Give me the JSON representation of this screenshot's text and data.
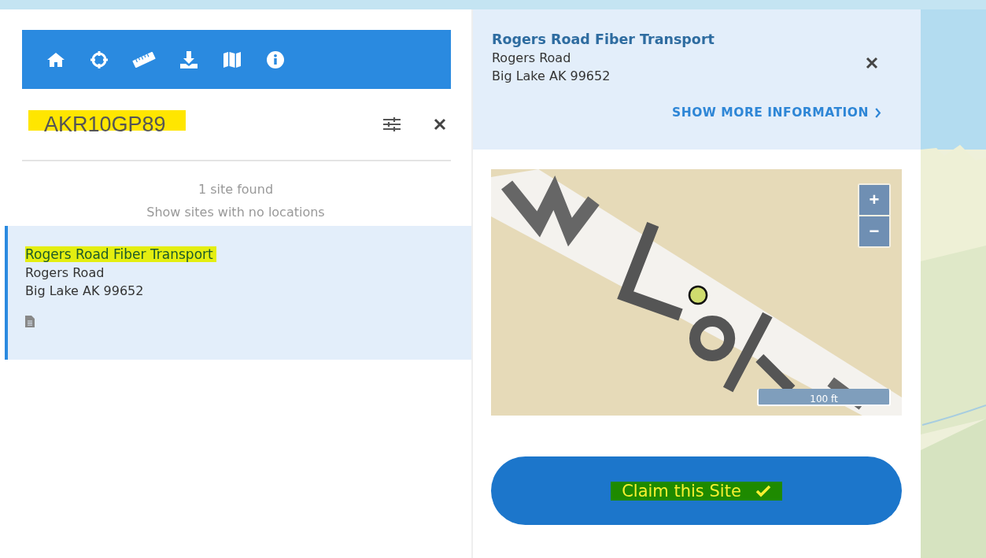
{
  "toolbar": {
    "buttons": [
      {
        "kind": "home"
      },
      {
        "kind": "locate"
      },
      {
        "kind": "measure"
      },
      {
        "kind": "download"
      },
      {
        "kind": "basemap"
      },
      {
        "kind": "info"
      }
    ]
  },
  "search": {
    "value": "AKR10GP89",
    "highlighted": true
  },
  "results": {
    "count": "1 site found",
    "no_location_link": "Show sites with no locations",
    "items": [
      {
        "name": "Rogers Road Fiber Transport",
        "highlighted": true,
        "street": "Rogers Road",
        "city": "Big Lake AK 99652",
        "selected": true
      }
    ]
  },
  "detail": {
    "name": "Rogers Road Fiber Transport",
    "street": "Rogers Road",
    "city": "Big Lake AK 99652",
    "more_link": "SHOW MORE INFORMATION",
    "map": {
      "zoom_in": "+",
      "zoom_out": "−",
      "scale": "100 ft"
    },
    "claim_button": {
      "label": "Claim this Site",
      "highlighted": true
    }
  }
}
